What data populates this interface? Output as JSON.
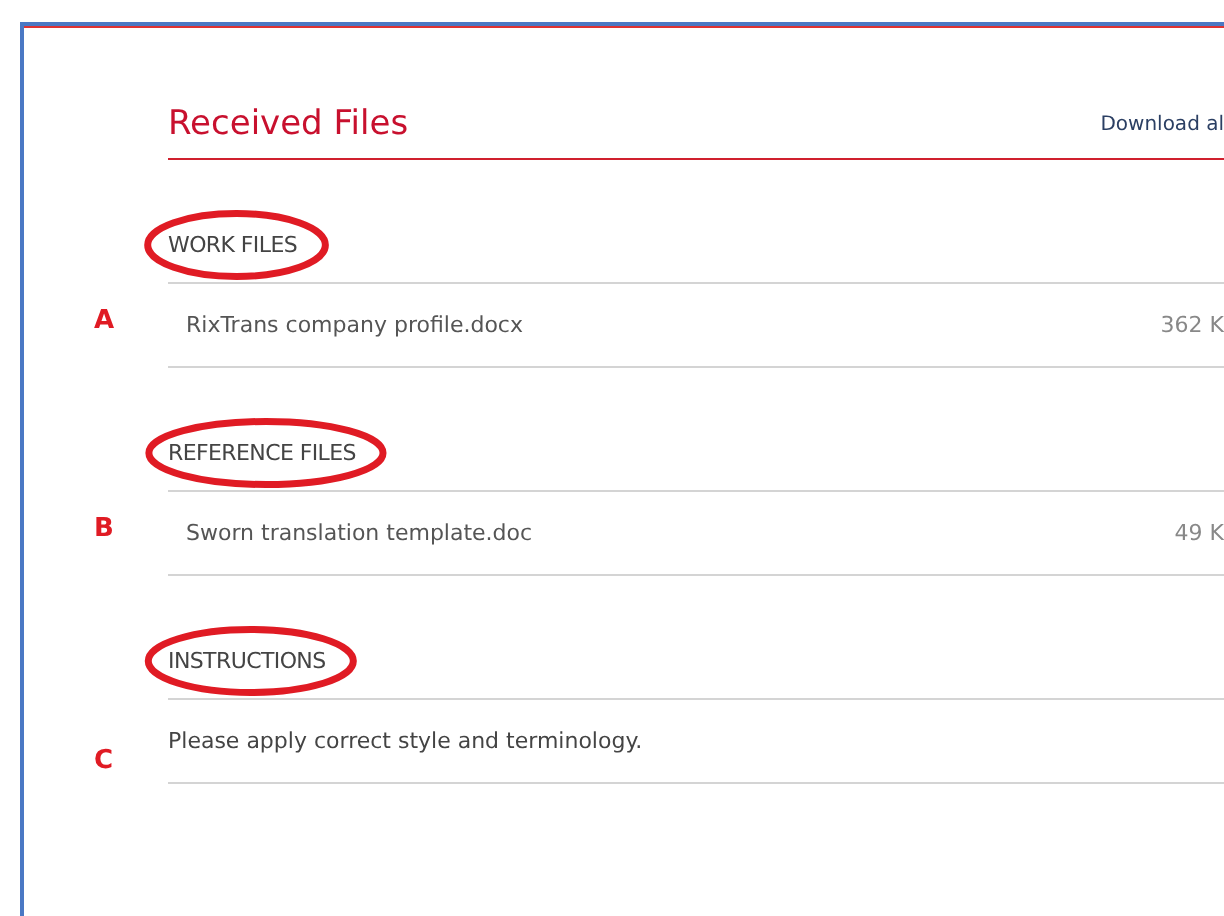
{
  "title": "Received Files",
  "download_link": "Download al",
  "sections": [
    {
      "kind": "files",
      "marker": "A",
      "heading": "WORK FILES",
      "circled": true,
      "files": [
        {
          "name": "RixTrans company profile.docx",
          "size": "362 K"
        }
      ]
    },
    {
      "kind": "files",
      "marker": "B",
      "heading": "REFERENCE FILES",
      "circled": true,
      "files": [
        {
          "name": "Sworn translation template.doc",
          "size": "49 K"
        }
      ]
    },
    {
      "kind": "text",
      "marker": "C",
      "heading": "INSTRUCTIONS",
      "circled": true,
      "text": "Please apply correct style and terminology."
    }
  ]
}
